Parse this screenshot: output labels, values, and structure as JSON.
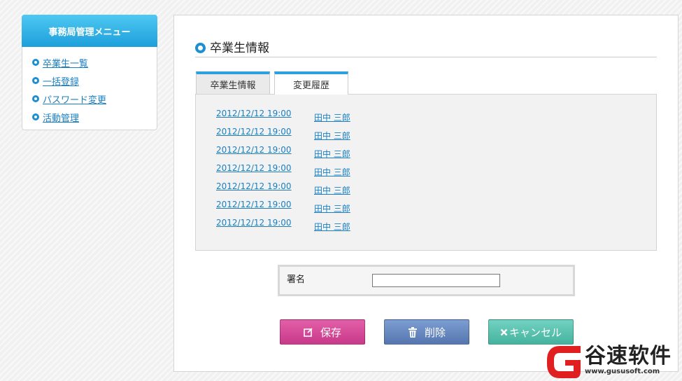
{
  "sidebar": {
    "title": "事務局管理メニュー",
    "items": [
      {
        "label": "卒業生一覧"
      },
      {
        "label": "一括登録"
      },
      {
        "label": "パスワード変更"
      },
      {
        "label": "活動管理"
      }
    ]
  },
  "main": {
    "title": "卒業生情報",
    "tabs": [
      {
        "label": "卒業生情報",
        "active": false
      },
      {
        "label": "変更履歴",
        "active": true
      }
    ],
    "history": [
      {
        "date": "2012/12/12 19:00",
        "name": "田中 三郎"
      },
      {
        "date": "2012/12/12 19:00",
        "name": "田中 三郎"
      },
      {
        "date": "2012/12/12 19:00",
        "name": "田中 三郎"
      },
      {
        "date": "2012/12/12 19:00",
        "name": "田中 三郎"
      },
      {
        "date": "2012/12/12 19:00",
        "name": "田中 三郎"
      },
      {
        "date": "2012/12/12 19:00",
        "name": "田中 三郎"
      },
      {
        "date": "2012/12/12 19:00",
        "name": "田中 三郎"
      }
    ],
    "signature": {
      "label": "署名",
      "value": ""
    },
    "buttons": {
      "save": "保存",
      "delete": "削除",
      "cancel": "キャンセル"
    }
  },
  "watermark": {
    "text": "谷速软件",
    "url": "www.gususoft.com"
  },
  "colors": {
    "accent": "#1d9fdb",
    "link": "#1a7fc1",
    "save": "#d0449a",
    "delete": "#6384c0",
    "cancel": "#55c0ad",
    "watermark": "#e02020"
  },
  "icons": {
    "menu_bullet": "circle-bullet-icon",
    "title": "circle-bullet-icon",
    "save": "edit-icon",
    "delete": "trash-icon",
    "cancel": "close-icon"
  }
}
